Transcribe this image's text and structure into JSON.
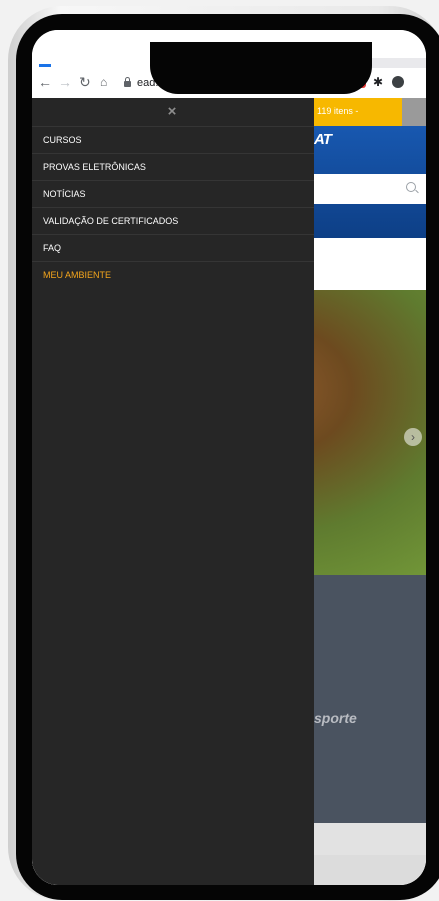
{
  "browser": {
    "url": "ead.sestsenat.org.br",
    "icons": [
      "back-arrow-icon",
      "forward-arrow-icon",
      "reload-icon",
      "home-icon",
      "lock-icon",
      "star-icon",
      "extension-icons"
    ]
  },
  "page": {
    "cart_text": "119 itens -",
    "logo_fragment": "AT",
    "hero_caption_fragment": "sporte"
  },
  "drawer": {
    "close_icon": "×",
    "items": [
      {
        "label": "CURSOS"
      },
      {
        "label": "PROVAS ELETRÔNICAS"
      },
      {
        "label": "NOTÍCIAS"
      },
      {
        "label": "VALIDAÇÃO DE CERTIFICADOS"
      },
      {
        "label": "FAQ"
      },
      {
        "label": "MEU AMBIENTE",
        "active": true
      }
    ]
  },
  "colors": {
    "drawer_bg": "#262626",
    "accent": "#f4a51c",
    "brand_blue": "#1858b0",
    "cart_yellow": "#f7b800"
  }
}
